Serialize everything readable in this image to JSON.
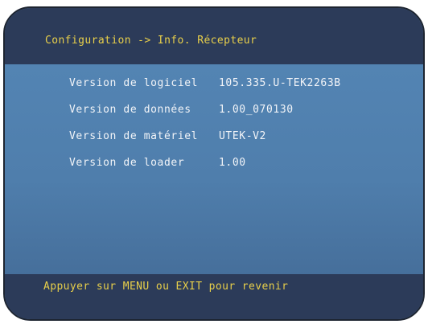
{
  "header": {
    "title": "Configuration -> Info. Récepteur"
  },
  "info": {
    "rows": [
      {
        "label": "Version de logiciel",
        "value": "105.335.U-TEK2263B"
      },
      {
        "label": "Version de données",
        "value": "1.00_070130"
      },
      {
        "label": "Version de matériel",
        "value": "UTEK-V2"
      },
      {
        "label": "Version de loader",
        "value": "1.00"
      }
    ]
  },
  "footer": {
    "hint": "Appuyer sur MENU ou EXIT pour revenir"
  },
  "colors": {
    "title_text": "#e8cf4a",
    "body_text": "#f2f4f8",
    "bar_background": "#2c3b59",
    "panel_background": "#4e7aa6"
  }
}
